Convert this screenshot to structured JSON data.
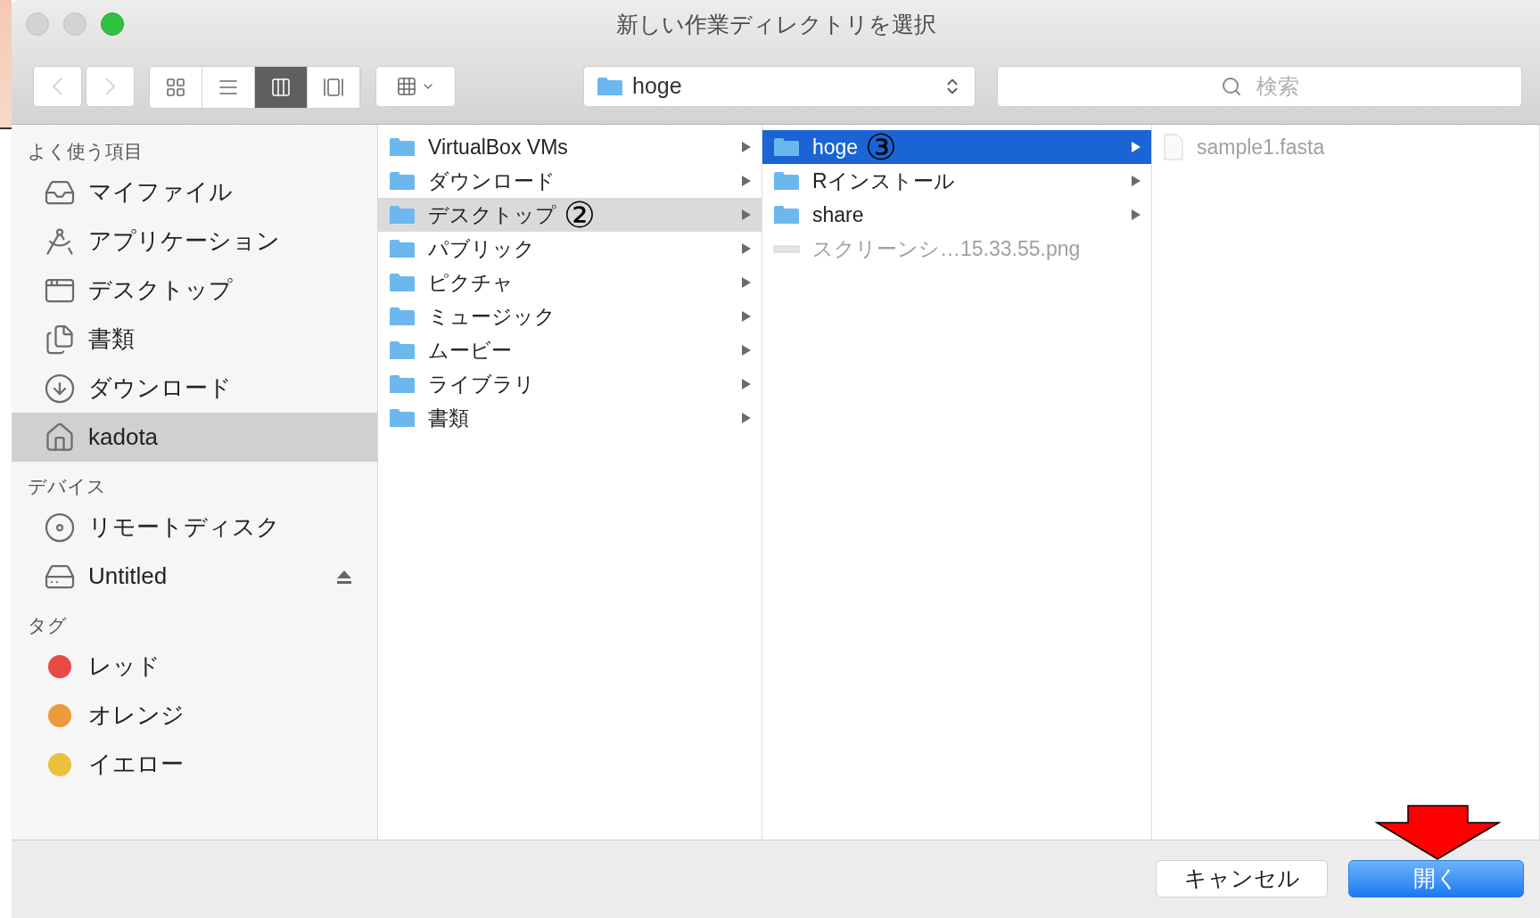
{
  "window": {
    "title": "新しい作業ディレクトリを選択"
  },
  "toolbar": {
    "back_disabled": true,
    "forward_disabled": true,
    "view_modes": [
      {
        "kind": "icons",
        "selected": false
      },
      {
        "kind": "list",
        "selected": false
      },
      {
        "kind": "columns",
        "selected": true
      },
      {
        "kind": "coverflow",
        "selected": false
      }
    ],
    "path_popup": {
      "label": "hoge"
    },
    "search": {
      "placeholder": "検索"
    }
  },
  "sidebar": {
    "sections": [
      {
        "heading": "よく使う項目",
        "items": [
          {
            "label": "マイファイル",
            "kind": "allfiles",
            "selected": false
          },
          {
            "label": "アプリケーション",
            "kind": "apps",
            "selected": false
          },
          {
            "label": "デスクトップ",
            "kind": "desktop",
            "selected": false
          },
          {
            "label": "書類",
            "kind": "documents",
            "selected": false
          },
          {
            "label": "ダウンロード",
            "kind": "downloads",
            "selected": false
          },
          {
            "label": "kadota",
            "kind": "home",
            "selected": true
          }
        ]
      },
      {
        "heading": "デバイス",
        "items": [
          {
            "label": "リモートディスク",
            "kind": "disc",
            "selected": false,
            "eject": false
          },
          {
            "label": "Untitled",
            "kind": "drive",
            "selected": false,
            "eject": true
          }
        ]
      },
      {
        "heading": "タグ",
        "items": [
          {
            "label": "レッド",
            "kind": "tag",
            "selected": false,
            "color": "#e84a45"
          },
          {
            "label": "オレンジ",
            "kind": "tag",
            "selected": false,
            "color": "#ec9a3a"
          },
          {
            "label": "イエロー",
            "kind": "tag",
            "selected": false,
            "color": "#e8c23a"
          }
        ]
      }
    ]
  },
  "columns": [
    {
      "focused": false,
      "items": [
        {
          "label": "VirtualBox VMs",
          "kind": "folder",
          "selected": false,
          "disabled": false,
          "has_children": true
        },
        {
          "label": "ダウンロード",
          "kind": "folder",
          "selected": false,
          "disabled": false,
          "has_children": true
        },
        {
          "label": "デスクトップ",
          "kind": "folder",
          "selected": true,
          "disabled": false,
          "has_children": true,
          "annotation": "②"
        },
        {
          "label": "パブリック",
          "kind": "folder",
          "selected": false,
          "disabled": false,
          "has_children": true
        },
        {
          "label": "ピクチャ",
          "kind": "folder",
          "selected": false,
          "disabled": false,
          "has_children": true
        },
        {
          "label": "ミュージック",
          "kind": "folder",
          "selected": false,
          "disabled": false,
          "has_children": true
        },
        {
          "label": "ムービー",
          "kind": "folder",
          "selected": false,
          "disabled": false,
          "has_children": true
        },
        {
          "label": "ライブラリ",
          "kind": "folder",
          "selected": false,
          "disabled": false,
          "has_children": true
        },
        {
          "label": "書類",
          "kind": "folder",
          "selected": false,
          "disabled": false,
          "has_children": true
        }
      ]
    },
    {
      "focused": true,
      "items": [
        {
          "label": "hoge",
          "kind": "folder",
          "selected": true,
          "disabled": false,
          "has_children": true,
          "annotation": "③"
        },
        {
          "label": "Rインストール",
          "kind": "folder",
          "selected": false,
          "disabled": false,
          "has_children": true
        },
        {
          "label": "share",
          "kind": "folder",
          "selected": false,
          "disabled": false,
          "has_children": true
        },
        {
          "label": "スクリーンシ…15.33.55.png",
          "kind": "image",
          "selected": false,
          "disabled": true,
          "has_children": false
        }
      ]
    },
    {
      "items": [
        {
          "label": "sample1.fasta",
          "kind": "document",
          "selected": false,
          "disabled": true,
          "has_children": false
        }
      ]
    }
  ],
  "buttons": [
    {
      "label": "キャンセル",
      "kind": "default"
    },
    {
      "label": "開く",
      "kind": "primary"
    }
  ],
  "pointer_arrow": true
}
